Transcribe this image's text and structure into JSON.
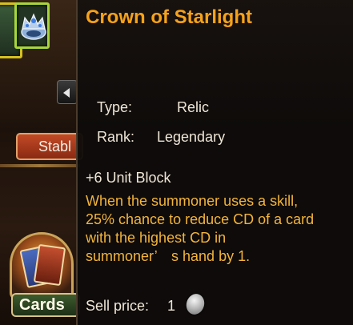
{
  "background": {
    "stable_button_label": "Stabl",
    "cards_button_label": "Cards"
  },
  "tooltip": {
    "item_name": "Crown of Starlight",
    "type_label": "Type:",
    "type_value": "Relic",
    "rank_label": "Rank:",
    "rank_value": "Legendary",
    "stat": "+6 Unit Block",
    "description_lines": [
      "When the summoner uses a skill,",
      "25% chance to reduce CD of a card",
      "with the highest CD in",
      "summoner’　s hand by 1."
    ],
    "sell_price_label": "Sell price:",
    "sell_price_value": "1",
    "currency_icon": "silver-coin-icon"
  },
  "colors": {
    "item_name": "#f6a21a",
    "description": "#f3b43a",
    "body_text": "#efe6d6",
    "tooltip_bg": "#0e0b0a"
  }
}
